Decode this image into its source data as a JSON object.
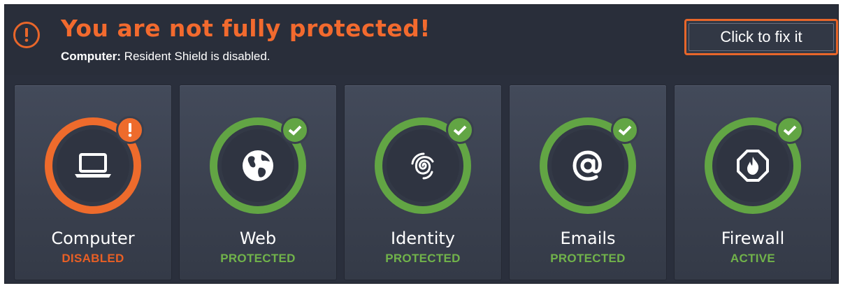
{
  "alert": {
    "headline": "You are not fully protected!",
    "detail_key": "Computer:",
    "detail_text": " Resident Shield is disabled.",
    "fix_button_label": "Click to fix it"
  },
  "colors": {
    "warning": "#ee6b2c",
    "ok": "#62a544",
    "panel": "#2a2f3c"
  },
  "tiles": [
    {
      "title": "Computer",
      "status": "DISABLED",
      "state": "warning",
      "icon": "laptop-icon",
      "badge": "exclamation-icon"
    },
    {
      "title": "Web",
      "status": "PROTECTED",
      "state": "ok",
      "icon": "globe-icon",
      "badge": "checkmark-icon"
    },
    {
      "title": "Identity",
      "status": "PROTECTED",
      "state": "ok",
      "icon": "fingerprint-icon",
      "badge": "checkmark-icon"
    },
    {
      "title": "Emails",
      "status": "PROTECTED",
      "state": "ok",
      "icon": "at-sign-icon",
      "badge": "checkmark-icon"
    },
    {
      "title": "Firewall",
      "status": "ACTIVE",
      "state": "ok",
      "icon": "firewall-flame-icon",
      "badge": "checkmark-icon"
    }
  ]
}
